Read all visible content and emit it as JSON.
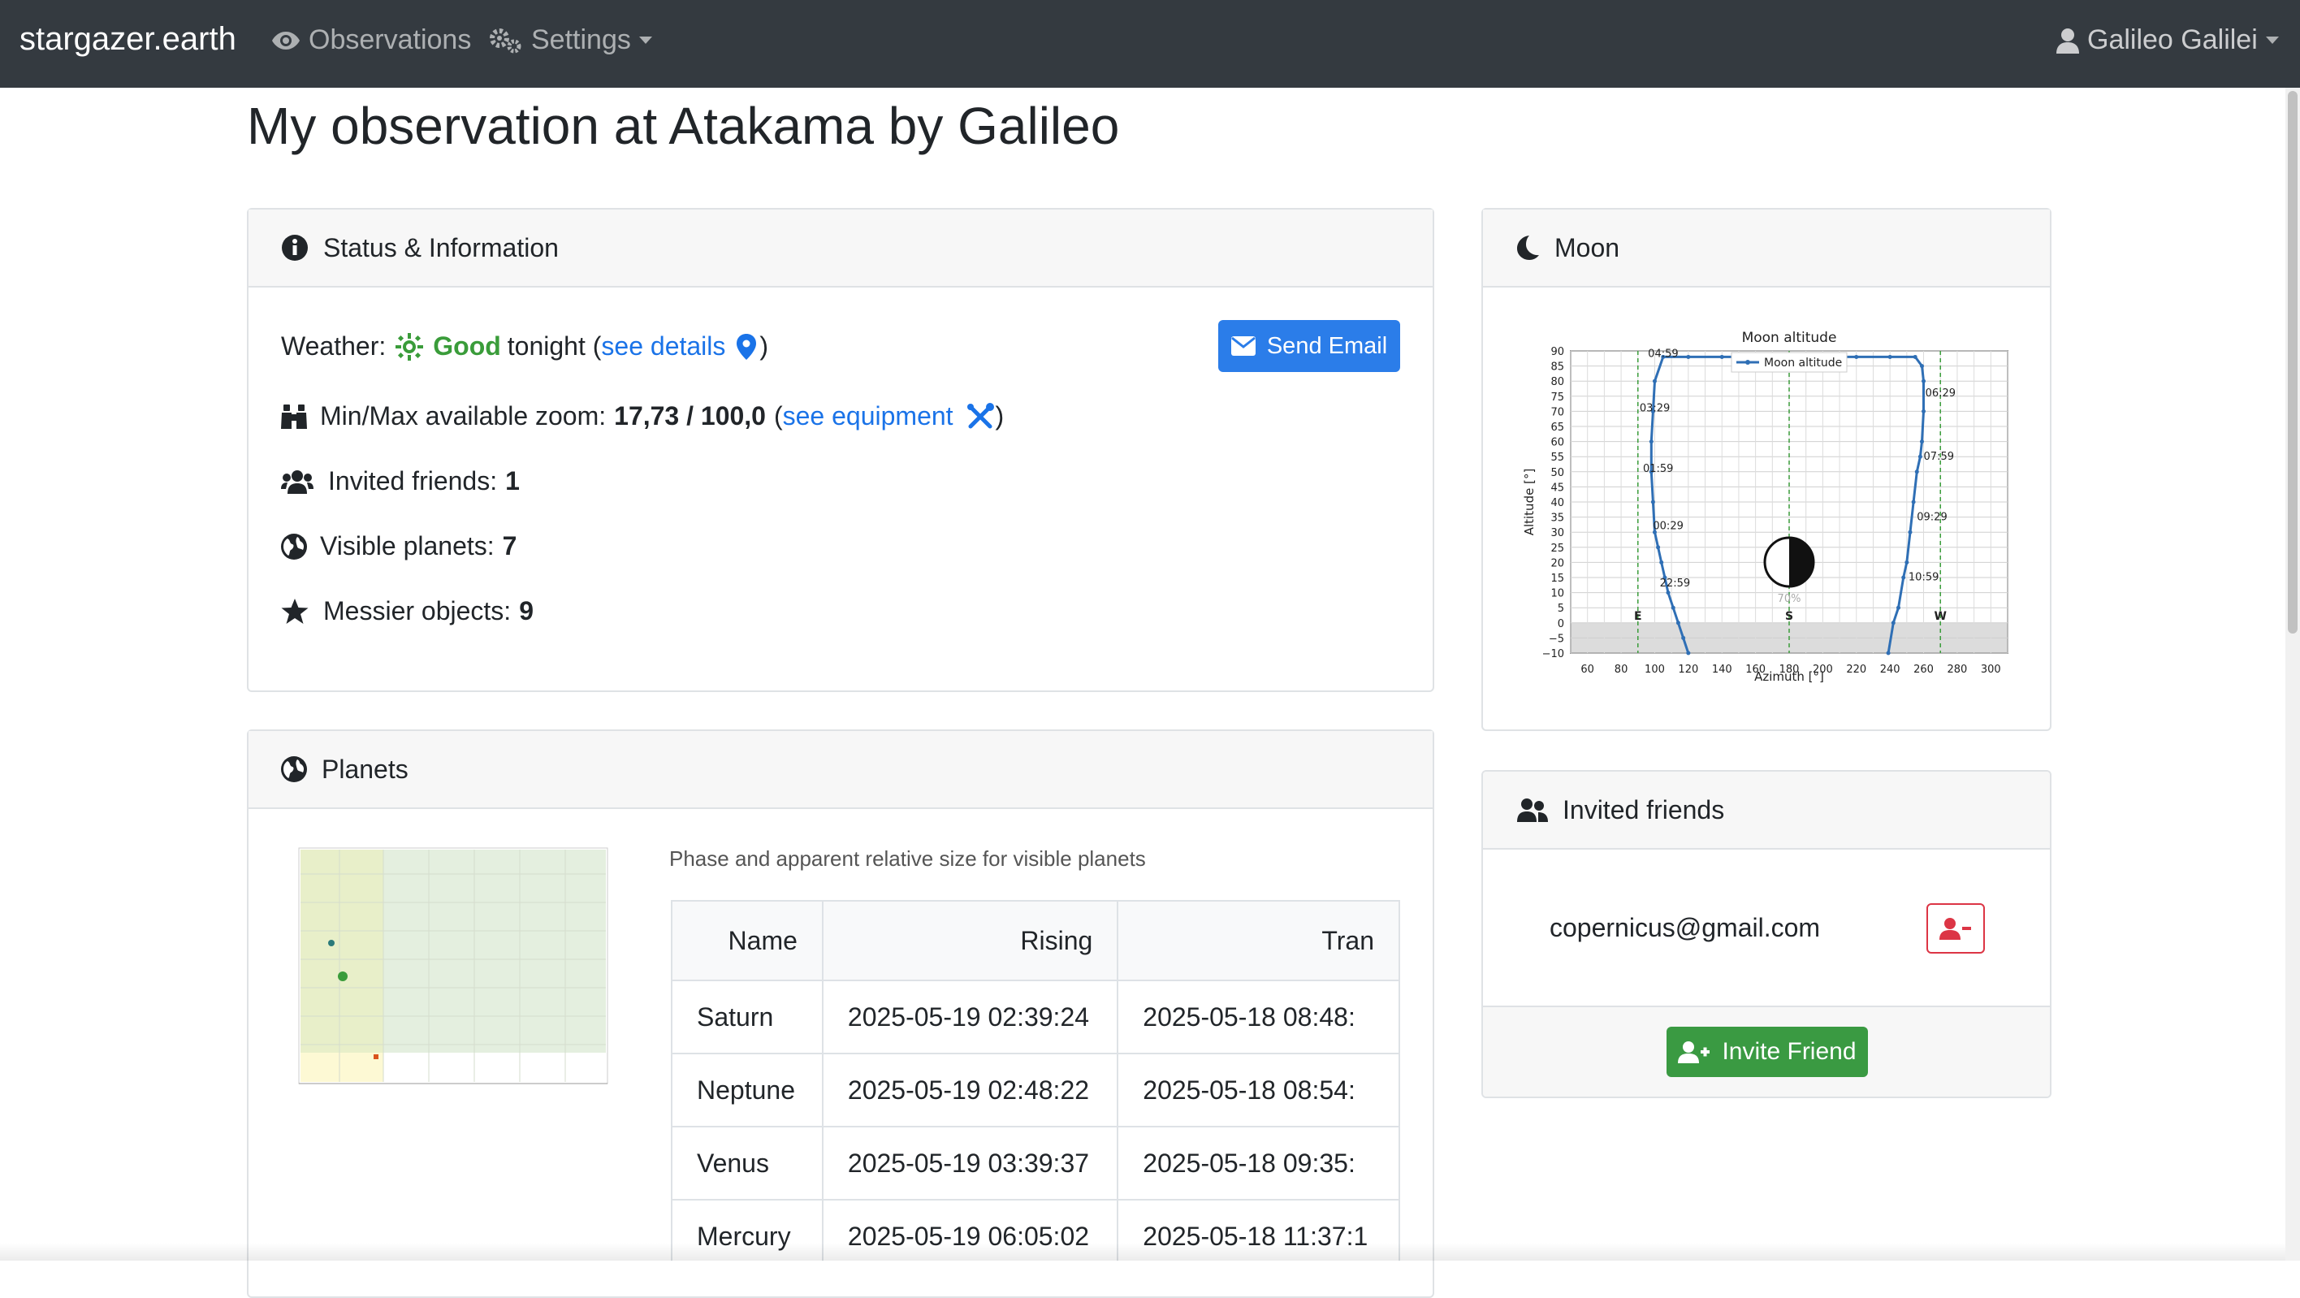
{
  "navbar": {
    "brand": "stargazer.earth",
    "observations": "Observations",
    "settings": "Settings",
    "user": "Galileo Galilei"
  },
  "page": {
    "title": "My observation at Atakama by Galileo"
  },
  "status": {
    "header": "Status & Information",
    "weather_label": "Weather:",
    "weather_value": "Good",
    "weather_suffix": "tonight (",
    "weather_link": "see details",
    "close_paren": ")",
    "email_button": "Send Email",
    "zoom_label": "Min/Max available zoom:",
    "zoom_value": "17,73 / 100,0",
    "open_paren": "(",
    "equipment_link": "see equipment",
    "friends_label": "Invited friends:",
    "friends_value": "1",
    "planets_label": "Visible planets:",
    "planets_value": "7",
    "messier_label": "Messier objects:",
    "messier_value": "9"
  },
  "planets": {
    "header": "Planets",
    "caption": "Phase and apparent relative size for visible planets",
    "columns": [
      "Name",
      "Rising",
      "Tran"
    ],
    "rows": [
      [
        "Saturn",
        "2025-05-19 02:39:24",
        "2025-05-18 08:48:"
      ],
      [
        "Neptune",
        "2025-05-19 02:48:22",
        "2025-05-18 08:54:"
      ],
      [
        "Venus",
        "2025-05-19 03:39:37",
        "2025-05-18 09:35:"
      ],
      [
        "Mercury",
        "2025-05-19 06:05:02",
        "2025-05-18 11:37:1"
      ]
    ]
  },
  "moon": {
    "header": "Moon",
    "illumination": "70%"
  },
  "chart_data": {
    "type": "line",
    "title": "Moon altitude",
    "xlabel": "Azimuth [°]",
    "ylabel": "Altitude [°]",
    "xlim": [
      50,
      310
    ],
    "ylim": [
      -10,
      90
    ],
    "x_ticks": [
      60,
      80,
      100,
      120,
      140,
      160,
      180,
      200,
      220,
      240,
      260,
      280,
      300
    ],
    "y_ticks": [
      -10,
      -5,
      0,
      5,
      10,
      15,
      20,
      25,
      30,
      35,
      40,
      45,
      50,
      55,
      60,
      65,
      70,
      75,
      80,
      85,
      90
    ],
    "grid": true,
    "legend_position": "top-center",
    "series": [
      {
        "name": "Moon altitude",
        "x": [
          120,
          117,
          114,
          111,
          108,
          106,
          104,
          102,
          100,
          99,
          98,
          98,
          99,
          100,
          105,
          120,
          140,
          160,
          180,
          200,
          220,
          240,
          255,
          259,
          260,
          260,
          259,
          258,
          256,
          254,
          252,
          250,
          248,
          245,
          242,
          239
        ],
        "y": [
          -10,
          -5,
          0,
          5,
          10,
          15,
          20,
          25,
          30,
          40,
          50,
          60,
          70,
          80,
          88,
          88,
          88,
          88,
          88,
          88,
          88,
          88,
          88,
          85,
          80,
          70,
          60,
          55,
          50,
          40,
          30,
          20,
          15,
          5,
          0,
          -10
        ]
      }
    ],
    "annotations": [
      {
        "x": 96,
        "y": 88,
        "text": "04:59"
      },
      {
        "x": 91,
        "y": 70,
        "text": "03:29"
      },
      {
        "x": 93,
        "y": 50,
        "text": "01:59"
      },
      {
        "x": 99,
        "y": 31,
        "text": "00:29"
      },
      {
        "x": 103,
        "y": 12,
        "text": "22:59"
      },
      {
        "x": 261,
        "y": 75,
        "text": "06:29"
      },
      {
        "x": 260,
        "y": 54,
        "text": "07:59"
      },
      {
        "x": 256,
        "y": 34,
        "text": "09:29"
      },
      {
        "x": 251,
        "y": 14,
        "text": "10:59"
      }
    ],
    "vlines": [
      {
        "x": 90,
        "label": "E"
      },
      {
        "x": 180,
        "label": "S"
      },
      {
        "x": 270,
        "label": "W"
      }
    ]
  },
  "friends": {
    "header": "Invited friends",
    "list": [
      "copernicus@gmail.com"
    ],
    "invite_button": "Invite Friend"
  }
}
